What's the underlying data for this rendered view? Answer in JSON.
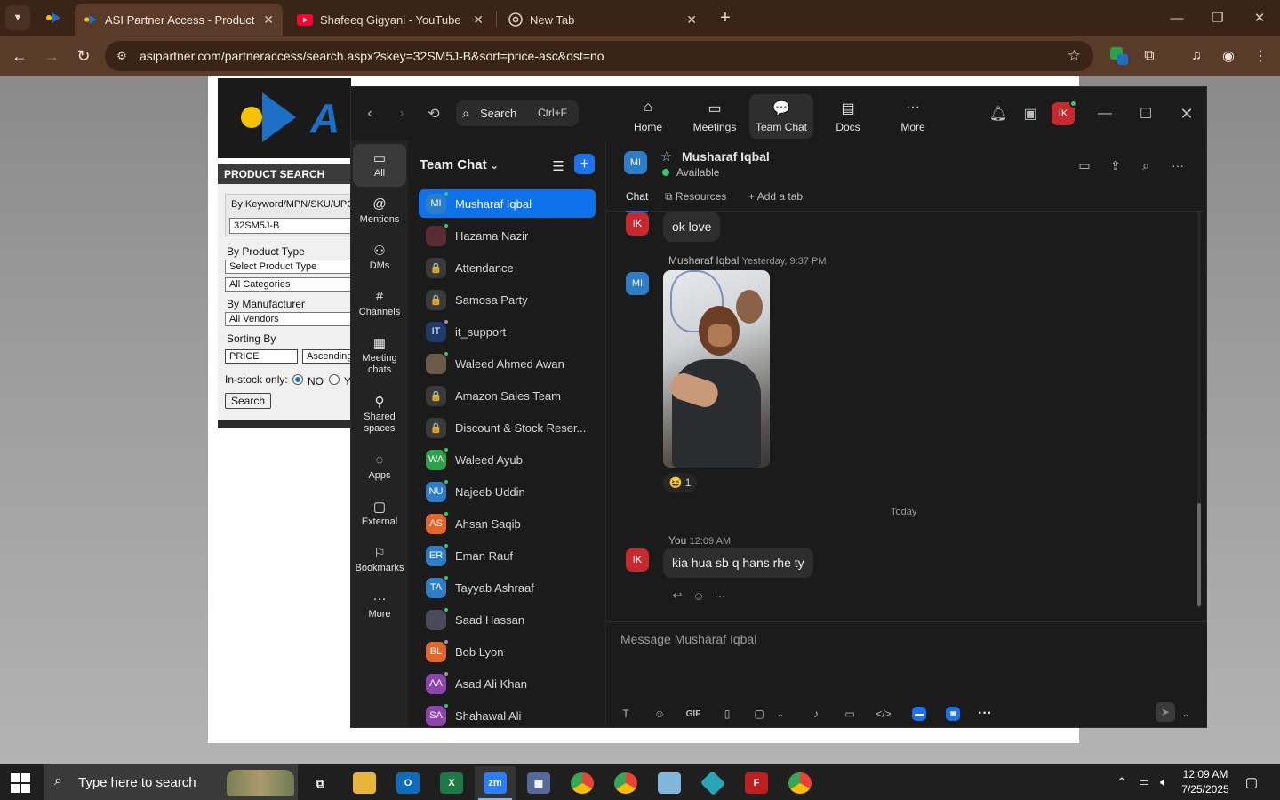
{
  "browser": {
    "tabs": [
      {
        "title": "ASI Partner Access - Product Se",
        "favicon": "asi-logo-icon",
        "active": true
      },
      {
        "title": "Shafeeq Gigyani - YouTube",
        "favicon": "youtube-icon",
        "active": false
      },
      {
        "title": "New Tab",
        "favicon": "chrome-icon",
        "active": false
      }
    ],
    "url": "asipartner.com/partneraccess/search.aspx?skey=32SM5J-B&sort=price-asc&ost=no"
  },
  "product_search": {
    "title": "PRODUCT SEARCH",
    "keyword_label": "By Keyword/MPN/SKU/UPC",
    "keyword_value": "32SM5J-B",
    "product_type_label": "By Product Type",
    "product_type_value": "Select Product Type",
    "category_value": "All Categories",
    "manufacturer_label": "By Manufacturer",
    "manufacturer_value": "All Vendors",
    "sorting_label": "Sorting By",
    "sort_field": "PRICE",
    "sort_order": "Ascending",
    "instock_label": "In-stock only:",
    "instock_no": "NO",
    "instock_yes": "Y",
    "search_button": "Search"
  },
  "zoom": {
    "search_label": "Search",
    "search_shortcut": "Ctrl+F",
    "nav": [
      {
        "label": "Home",
        "icon": "home-icon"
      },
      {
        "label": "Meetings",
        "icon": "video-camera-icon"
      },
      {
        "label": "Team Chat",
        "icon": "chat-bubbles-icon"
      },
      {
        "label": "Docs",
        "icon": "document-icon"
      },
      {
        "label": "More",
        "icon": "ellipsis-icon"
      }
    ],
    "user_initials": "IK",
    "rail": [
      {
        "label": "All",
        "icon": "chat-icon"
      },
      {
        "label": "Mentions",
        "icon": "at-icon"
      },
      {
        "label": "DMs",
        "icon": "people-icon"
      },
      {
        "label": "Channels",
        "icon": "hash-icon"
      },
      {
        "label": "Meeting chats",
        "icon": "calendar-icon"
      },
      {
        "label": "Shared spaces",
        "icon": "share-icon"
      },
      {
        "label": "Apps",
        "icon": "apps-icon"
      },
      {
        "label": "External",
        "icon": "external-icon"
      },
      {
        "label": "Bookmarks",
        "icon": "bookmark-icon"
      },
      {
        "label": "More",
        "icon": "ellipsis-icon"
      }
    ],
    "list_title": "Team Chat",
    "chats": [
      {
        "name": "Musharaf Iqbal",
        "initials": "MI",
        "color": "#2d7dc7",
        "presence": "#2ecc71"
      },
      {
        "name": "Hazama Nazir",
        "initials": "",
        "color": "#5a2a35",
        "presence": "#2ecc71"
      },
      {
        "name": "Attendance",
        "initials": "🔒",
        "color": "#3a3a3a",
        "presence": ""
      },
      {
        "name": "Samosa Party",
        "initials": "🔒",
        "color": "#3a3a3a",
        "presence": ""
      },
      {
        "name": "it_support",
        "initials": "IT",
        "color": "#1f3a6b",
        "presence": "#9a9a9a"
      },
      {
        "name": "Waleed Ahmed Awan",
        "initials": "",
        "color": "#6b5a4a",
        "presence": "#2ecc71"
      },
      {
        "name": "Amazon Sales Team",
        "initials": "🔒",
        "color": "#3a3a3a",
        "presence": ""
      },
      {
        "name": "Discount & Stock Reser...",
        "initials": "🔒",
        "color": "#3a3a3a",
        "presence": ""
      },
      {
        "name": "Waleed Ayub",
        "initials": "WA",
        "color": "#2aa24a",
        "presence": "#2ecc71"
      },
      {
        "name": "Najeeb Uddin",
        "initials": "NU",
        "color": "#2d7dc7",
        "presence": "#2ecc71"
      },
      {
        "name": "Ahsan Saqib",
        "initials": "AS",
        "color": "#e2652c",
        "presence": "#2ecc71"
      },
      {
        "name": "Eman Rauf",
        "initials": "ER",
        "color": "#2d7dc7",
        "presence": "#2ecc71"
      },
      {
        "name": "Tayyab Ashraaf",
        "initials": "TA",
        "color": "#2d7dc7",
        "presence": "#2ecc71"
      },
      {
        "name": "Saad Hassan",
        "initials": "",
        "color": "#4a4a5a",
        "presence": "#2ecc71"
      },
      {
        "name": "Bob Lyon",
        "initials": "BL",
        "color": "#e2652c",
        "presence": "#9a9a9a"
      },
      {
        "name": "Asad Ali Khan",
        "initials": "AA",
        "color": "#8e44ad",
        "presence": "#9a9a9a"
      },
      {
        "name": "Shahawal Ali",
        "initials": "SA",
        "color": "#8e44ad",
        "presence": "#2ecc71"
      }
    ],
    "conversation": {
      "name": "Musharaf Iqbal",
      "initials": "MI",
      "status": "Available",
      "tabs": [
        "Chat",
        "Resources",
        "Add a tab"
      ],
      "messages": {
        "m1_text": "ok love",
        "m2_sender": "Musharaf Iqbal",
        "m2_time": "Yesterday, 9:37 PM",
        "m2_reaction_count": "1",
        "day_separator": "Today",
        "m3_sender": "You",
        "m3_time": "12:09 AM",
        "m3_text": "kia hua sb q hans rhe ty"
      },
      "composer_placeholder": "Message Musharaf Iqbal"
    }
  },
  "taskbar": {
    "search_placeholder": "Type here to search",
    "time": "12:09 AM",
    "date": "7/25/2025"
  }
}
